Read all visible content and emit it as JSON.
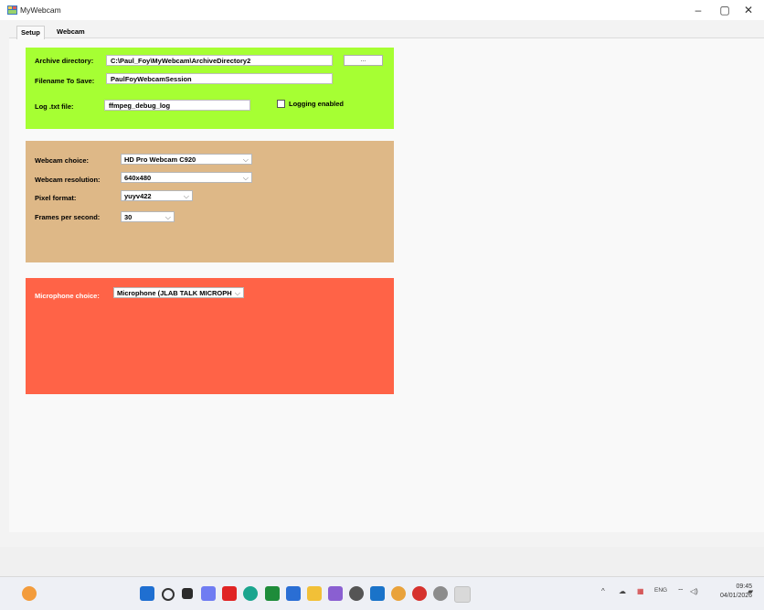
{
  "window": {
    "title": "MyWebcam",
    "minimize": "–",
    "maximize": "▢",
    "close": "✕"
  },
  "tabs": [
    {
      "label": "Setup"
    },
    {
      "label": "Webcam"
    }
  ],
  "archive": {
    "archive_dir_label": "Archive directory:",
    "archive_dir_value": "C:\\Paul_Foy\\MyWebcam\\ArchiveDirectory2",
    "browse_label": "...",
    "filename_label": "Filename To Save:",
    "filename_value": "PaulFoyWebcamSession",
    "log_label": "Log .txt file:",
    "log_value": "ffmpeg_debug_log",
    "logging_label": "Logging enabled",
    "logging_checked": false
  },
  "webcam": {
    "choice_label": "Webcam choice:",
    "choice_value": "HD Pro Webcam C920",
    "resolution_label": "Webcam resolution:",
    "resolution_value": "640x480",
    "pixel_label": "Pixel format:",
    "pixel_value": "yuyv422",
    "fps_label": "Frames per second:",
    "fps_value": "30"
  },
  "microphone": {
    "choice_label": "Microphone choice:",
    "choice_value": "Microphone (JLAB TALK MICROPH"
  },
  "colors": {
    "archive_panel": "#a6ff33",
    "webcam_panel": "#deb887",
    "mic_panel": "#ff6347"
  },
  "taskbar": {
    "icons": [
      "weather-icon",
      "start-icon",
      "search-icon",
      "task-view-icon",
      "copilot-icon",
      "youtube-icon",
      "edge-icon",
      "xbox-icon",
      "store-icon",
      "file-explorer-icon",
      "visual-studio-icon",
      "chatgpt-icon",
      "outlook-icon",
      "chrome-icon",
      "app-icon",
      "settings-icon",
      "mywebcam-app-icon"
    ],
    "tray_language": "ENG",
    "time": "09:45",
    "date": "04/01/2026"
  }
}
